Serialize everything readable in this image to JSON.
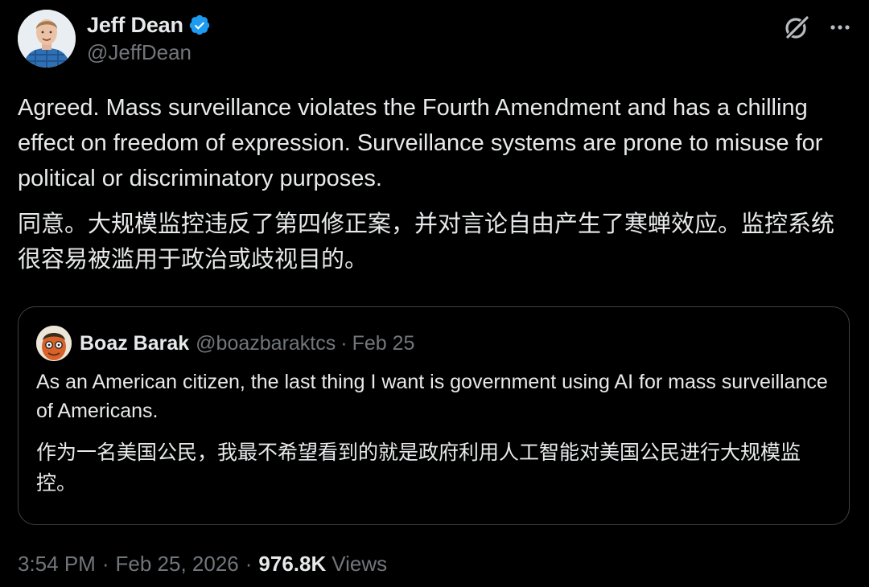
{
  "author": {
    "display_name": "Jeff Dean",
    "handle": "@JeffDean",
    "verified": true,
    "verified_color": "#1d9bf0"
  },
  "header_icons": {
    "grok": "grok-icon",
    "more": "more-icon"
  },
  "tweet": {
    "text_en": "Agreed.  Mass surveillance violates the Fourth Amendment and has a chilling effect on freedom of expression. Surveillance systems are prone to misuse for political or discriminatory purposes.",
    "text_cn": "同意。大规模监控违反了第四修正案，并对言论自由产生了寒蝉效应。监控系统很容易被滥用于政治或歧视目的。"
  },
  "quote": {
    "display_name": "Boaz Barak",
    "handle": "@boazbaraktcs",
    "separator": "·",
    "date": "Feb 25",
    "text_en": "As an American citizen, the last thing I want is government using AI for mass surveillance of Americans.",
    "text_cn": "作为一名美国公民，我最不希望看到的就是政府利用人工智能对美国公民进行大规模监控。"
  },
  "footer": {
    "time": "3:54 PM",
    "separator": "·",
    "date": "Feb 25, 2026",
    "views_count": "976.8K",
    "views_label": "Views"
  },
  "colors": {
    "background": "#000000",
    "text_primary": "#e7e9ea",
    "text_secondary": "#71767b",
    "border": "#3e4144"
  }
}
